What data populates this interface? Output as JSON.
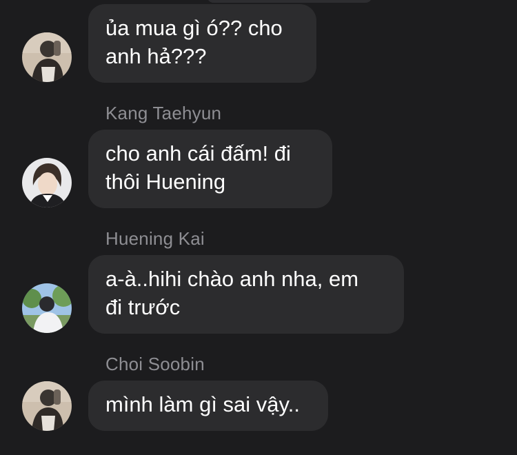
{
  "messages": [
    {
      "sender": "",
      "avatar": "soobin-avatar",
      "lines": [
        "ủa mua gì ó?? cho",
        "anh hả???"
      ]
    },
    {
      "sender": "Kang Taehyun",
      "avatar": "taehyun-avatar",
      "lines": [
        "cho anh cái đấm! đi",
        "thôi Huening"
      ]
    },
    {
      "sender": "Huening Kai",
      "avatar": "hueningkai-avatar",
      "lines": [
        "a-à..hihi chào anh nha, em",
        "đi trước"
      ]
    },
    {
      "sender": "Choi Soobin",
      "avatar": "soobin-avatar",
      "lines": [
        "mình làm gì sai vậy.."
      ]
    }
  ],
  "colors": {
    "background": "#1c1c1e",
    "bubble": "#2c2c2e",
    "sender_name": "#8e8e93",
    "text": "#ffffff"
  }
}
